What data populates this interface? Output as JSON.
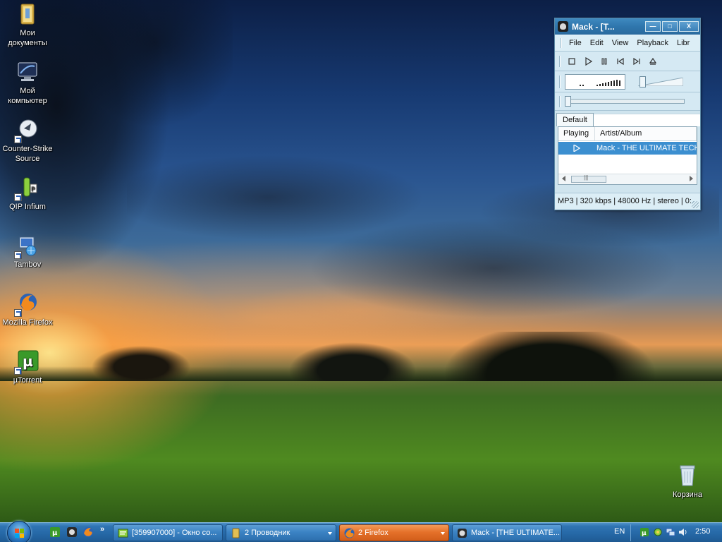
{
  "desktop": {
    "icons": [
      {
        "label": "Мои документы",
        "icon": "folder-documents-icon"
      },
      {
        "label": "Мой компьютер",
        "icon": "my-computer-icon"
      },
      {
        "label": "Counter-Strike Source",
        "icon": "counter-strike-icon"
      },
      {
        "label": "QIP Infium",
        "icon": "qip-icon"
      },
      {
        "label": "Tambov",
        "icon": "network-connection-icon"
      },
      {
        "label": "Mozilla Firefox",
        "icon": "firefox-icon"
      },
      {
        "label": "µTorrent",
        "icon": "utorrent-icon"
      },
      {
        "label": "Корзина",
        "icon": "recycle-bin-icon"
      }
    ]
  },
  "winamp": {
    "title": "Mack - [T...",
    "controls": {
      "minimize": "—",
      "maximize": "□",
      "close": "X"
    },
    "menu": [
      "File",
      "Edit",
      "View",
      "Playback",
      "Libr"
    ],
    "transport": [
      "stop",
      "play",
      "pause",
      "previous",
      "next",
      "eject"
    ],
    "tab": "Default",
    "playlist": {
      "columns": [
        "Playing",
        "Artist/Album"
      ],
      "rows": [
        {
          "artist_album": "Mack - THE ULTIMATE TECK"
        }
      ]
    },
    "status": "MP3 | 320 kbps | 48000 Hz | stereo | 0:"
  },
  "taskbar": {
    "quick_launch": [
      "utorrent-icon",
      "winamp-icon",
      "firefox-icon"
    ],
    "more": "»",
    "tasks": [
      {
        "label": "[359907000] - Окно со...",
        "icon": "chat-window-icon"
      },
      {
        "label": "2 Проводник",
        "icon": "explorer-folder-icon"
      },
      {
        "label": "2 Firefox",
        "icon": "firefox-icon"
      },
      {
        "label": "Mack - [THE ULTIMATE...",
        "icon": "winamp-icon"
      }
    ],
    "language": "EN",
    "tray_icons": [
      "utorrent-tray-icon",
      "qip-tray-icon",
      "network-tray-icon",
      "volume-tray-icon"
    ],
    "clock": "2:50"
  },
  "colors": {
    "taskbar": "#2567a5",
    "active_task": "#e5712a",
    "winamp_frame": "#2f76ad",
    "playlist_selection": "#3c8fd0"
  }
}
